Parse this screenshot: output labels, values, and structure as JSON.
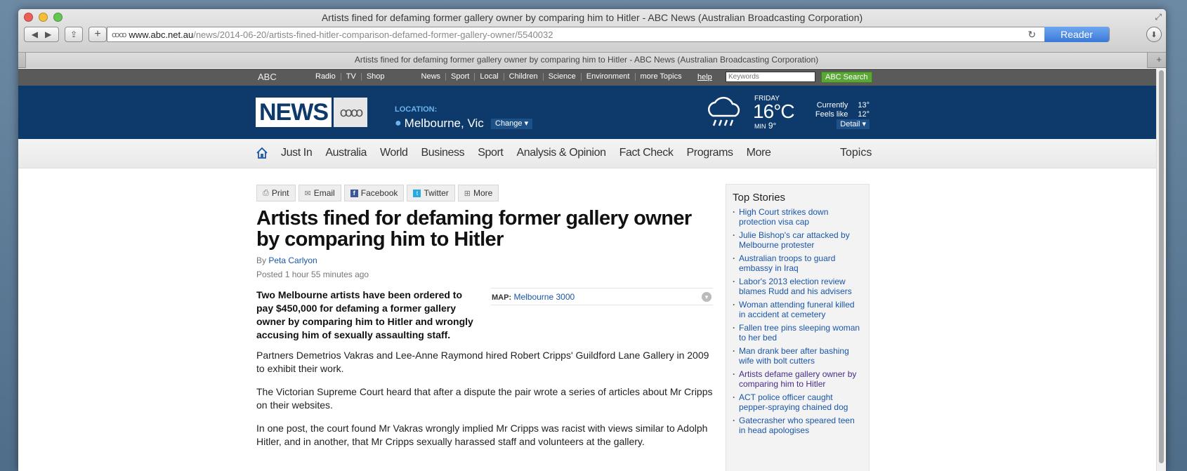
{
  "browser": {
    "window_title": "Artists fined for defaming former gallery owner by comparing him to Hitler - ABC News (Australian Broadcasting Corporation)",
    "url_host": "www.abc.net.au",
    "url_path": "/news/2014-06-20/artists-fined-hitler-comparison-defamed-former-gallery-owner/5540032",
    "reader_label": "Reader",
    "tab_title": "Artists fined for defaming former gallery owner by comparing him to Hitler - ABC News (Australian Broadcasting Corporation)"
  },
  "utility": {
    "logo": "ABC",
    "links": [
      "Radio",
      "TV",
      "Shop"
    ],
    "links2": [
      "News",
      "Sport",
      "Local",
      "Children",
      "Science",
      "Environment",
      "more Topics"
    ],
    "help": "help",
    "keywords_placeholder": "Keywords",
    "search_label": "ABC Search"
  },
  "header": {
    "news_logo": "NEWS",
    "location_label": "LOCATION:",
    "location": "Melbourne, Vic",
    "change_label": "Change ▾",
    "weather": {
      "day": "FRIDAY",
      "temp": "16°C",
      "min_label": "MIN",
      "min_value": "9°",
      "currently_label": "Currently",
      "currently_value": "13°",
      "feels_label": "Feels like",
      "feels_value": "12°",
      "detail_label": "Detail ▾"
    }
  },
  "nav": {
    "items": [
      "Just In",
      "Australia",
      "World",
      "Business",
      "Sport",
      "Analysis & Opinion",
      "Fact Check",
      "Programs",
      "More"
    ],
    "topics": "Topics"
  },
  "share": {
    "print": "Print",
    "email": "Email",
    "facebook": "Facebook",
    "twitter": "Twitter",
    "more": "More"
  },
  "article": {
    "headline": "Artists fined for defaming former gallery owner by comparing him to Hitler",
    "by_label": "By",
    "author": "Peta Carlyon",
    "posted": "Posted 1 hour 55 minutes ago",
    "lead": "Two Melbourne artists have been ordered to pay $450,000 for defaming a former gallery owner by comparing him to Hitler and wrongly accusing him of sexually assaulting staff.",
    "map_label": "MAP:",
    "map_value": "Melbourne 3000",
    "paragraphs": [
      "Partners Demetrios Vakras and Lee-Anne Raymond hired Robert Cripps' Guildford Lane Gallery in 2009 to exhibit their work.",
      "The Victorian Supreme Court heard that after a dispute the pair wrote a series of articles about Mr Cripps on their websites.",
      "In one post, the court found Mr Vakras wrongly implied Mr Cripps was racist with views similar to Adolph Hitler, and in another, that Mr Cripps sexually harassed staff and volunteers at the gallery."
    ]
  },
  "sidebar": {
    "title": "Top Stories",
    "stories": [
      "High Court strikes down protection visa cap",
      "Julie Bishop's car attacked by Melbourne protester",
      "Australian troops to guard embassy in Iraq",
      "Labor's 2013 election review blames Rudd and his advisers",
      "Woman attending funeral killed in accident at cemetery",
      "Fallen tree pins sleeping woman to her bed",
      "Man drank beer after bashing wife with bolt cutters",
      "Artists defame gallery owner by comparing him to Hitler",
      "ACT police officer caught pepper-spraying chained dog",
      "Gatecrasher who speared teen in head apologises"
    ]
  },
  "colors": {
    "abc_blue": "#0d3a6a",
    "link_blue": "#1a56a8",
    "visited": "#4a2b8a",
    "search_green": "#5aa636"
  }
}
